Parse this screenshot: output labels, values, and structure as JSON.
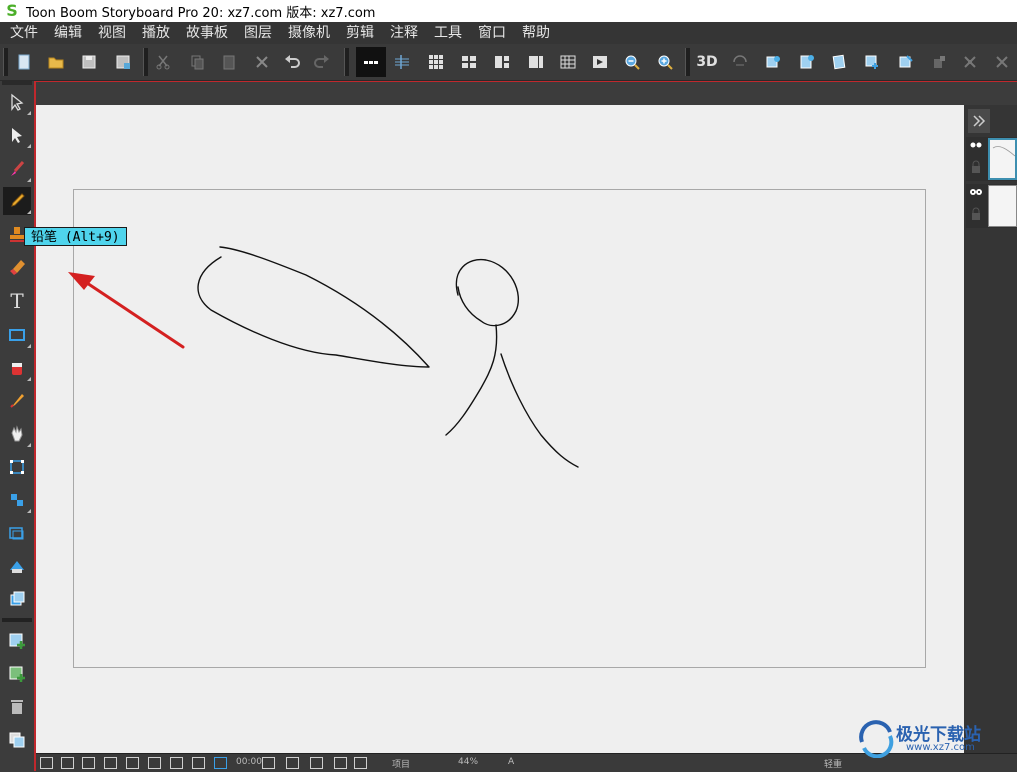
{
  "window": {
    "title": "Toon Boom Storyboard Pro 20: xz7.com 版本: xz7.com",
    "logo_glyph": "S"
  },
  "menu": [
    {
      "id": "file",
      "label": "文件"
    },
    {
      "id": "edit",
      "label": "编辑"
    },
    {
      "id": "view",
      "label": "视图"
    },
    {
      "id": "play",
      "label": "播放"
    },
    {
      "id": "storyboard",
      "label": "故事板"
    },
    {
      "id": "layer",
      "label": "图层"
    },
    {
      "id": "camera",
      "label": "摄像机"
    },
    {
      "id": "cut",
      "label": "剪辑"
    },
    {
      "id": "annotate",
      "label": "注释"
    },
    {
      "id": "tools",
      "label": "工具"
    },
    {
      "id": "window",
      "label": "窗口"
    },
    {
      "id": "help",
      "label": "帮助"
    }
  ],
  "toolbar": {
    "icons": [
      "new-icon",
      "open-icon",
      "save-icon",
      "save-as-icon",
      "cut-icon",
      "copy-icon",
      "paste-icon",
      "delete-icon",
      "undo-icon",
      "redo-icon",
      "panel-strip-icon",
      "sound-icon",
      "grid-icon",
      "layout-icon",
      "layout2-icon",
      "layout3-icon",
      "thumbnails-icon",
      "timeline-icon",
      "zoom-out-icon",
      "zoom-in-icon",
      "3d-icon",
      "3d-rotate-icon",
      "camera-icon",
      "scene-icon",
      "panel-icon",
      "layer-add-icon",
      "layer-edit-icon",
      "layer-lock-icon",
      "x-icon",
      "close-icon"
    ],
    "three_d_label": "3D"
  },
  "tooltip": {
    "text": "铅笔 (Alt+9)"
  },
  "tools": [
    {
      "name": "select-tool",
      "icon": "arrow-icon"
    },
    {
      "name": "transform-tool",
      "icon": "arrow-solid-icon"
    },
    {
      "name": "brush-tool",
      "icon": "brush-icon"
    },
    {
      "name": "pencil-tool",
      "icon": "pencil-icon",
      "active": true
    },
    {
      "name": "stamp-tool",
      "icon": "stamp-icon"
    },
    {
      "name": "eraser-tool",
      "icon": "eraser-icon"
    },
    {
      "name": "text-tool",
      "icon": "text-icon",
      "glyph": "T"
    },
    {
      "name": "rectangle-tool",
      "icon": "rectangle-icon"
    },
    {
      "name": "paint-tool",
      "icon": "paint-bucket-icon"
    },
    {
      "name": "dropper-tool",
      "icon": "dropper-icon"
    },
    {
      "name": "hand-tool",
      "icon": "hand-icon"
    },
    {
      "name": "select-points-tool",
      "icon": "select-points-icon"
    },
    {
      "name": "contour-tool",
      "icon": "contour-icon"
    },
    {
      "name": "cutter-tool",
      "icon": "cutter-icon"
    },
    {
      "name": "perspective-tool",
      "icon": "perspective-icon"
    },
    {
      "name": "layer-tool",
      "icon": "layer-stack-icon"
    },
    {
      "name": "add-panel-tool",
      "icon": "add-panel-icon"
    },
    {
      "name": "add-layer-tool",
      "icon": "add-layer-icon"
    },
    {
      "name": "delete-tool",
      "icon": "trash-icon"
    },
    {
      "name": "duplicate-tool",
      "icon": "duplicate-icon"
    }
  ],
  "bottombar": {
    "timecode": "00:00",
    "label_a": "项目",
    "zoom": "44%",
    "label_b": "A",
    "label_c": "轻重"
  },
  "watermark": {
    "text": "极光下载站",
    "sub": "www.xz7.com"
  },
  "colors": {
    "accent_red": "#c0282d",
    "tooltip_bg": "#4fd4ec",
    "selection_blue": "#3d8fb0"
  }
}
